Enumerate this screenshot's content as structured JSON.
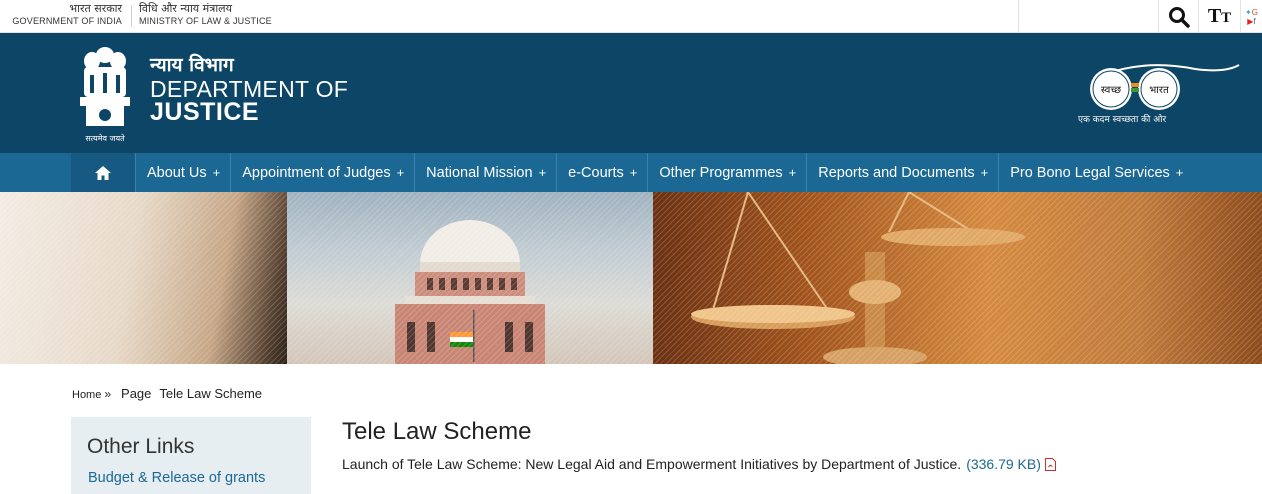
{
  "topbar": {
    "gov_hindi": "भारत सरकार",
    "gov_english": "GOVERNMENT OF INDIA",
    "ministry_hindi": "विधि और न्याय मंत्रालय",
    "ministry_english": "MINISTRY OF LAW & JUSTICE",
    "icons": [
      "search-icon",
      "text-size-icon",
      "twitter-icon",
      "youtube-icon",
      "google-icon",
      "facebook-icon"
    ]
  },
  "header": {
    "title_hindi": "न्याय विभाग",
    "title_line1": "DEPARTMENT OF",
    "title_line2": "JUSTICE",
    "emblem_motto": "सत्यमेव जयते",
    "swachh_left": "स्वच्छ",
    "swachh_right": "भारत",
    "swachh_tagline": "एक कदम स्वच्छता की ओर",
    "colors": {
      "header_bg": "#0d4566",
      "nav_bg": "#1b6895",
      "link": "#1b6895"
    }
  },
  "nav": {
    "home_icon": "home-icon",
    "items": [
      {
        "label": "About Us",
        "plus": "+"
      },
      {
        "label": "Appointment of Judges",
        "plus": "+"
      },
      {
        "label": "National Mission",
        "plus": "+"
      },
      {
        "label": "e-Courts",
        "plus": "+"
      },
      {
        "label": "Other Programmes",
        "plus": "+"
      },
      {
        "label": "Reports and Documents",
        "plus": "+"
      },
      {
        "label": "Pro Bono Legal Services",
        "plus": "+"
      }
    ]
  },
  "breadcrumb": {
    "home": "Home",
    "separator": "»",
    "page": "Page",
    "current": "Tele Law Scheme"
  },
  "sidebar": {
    "title": "Other Links",
    "links": [
      "Budget & Release of grants"
    ]
  },
  "main": {
    "title": "Tele Law Scheme",
    "document": {
      "text": "Launch of Tele Law Scheme: New Legal Aid and Empowerment Initiatives by Department of Justice.",
      "size": "(336.79 KB)",
      "icon": "pdf-icon"
    }
  }
}
